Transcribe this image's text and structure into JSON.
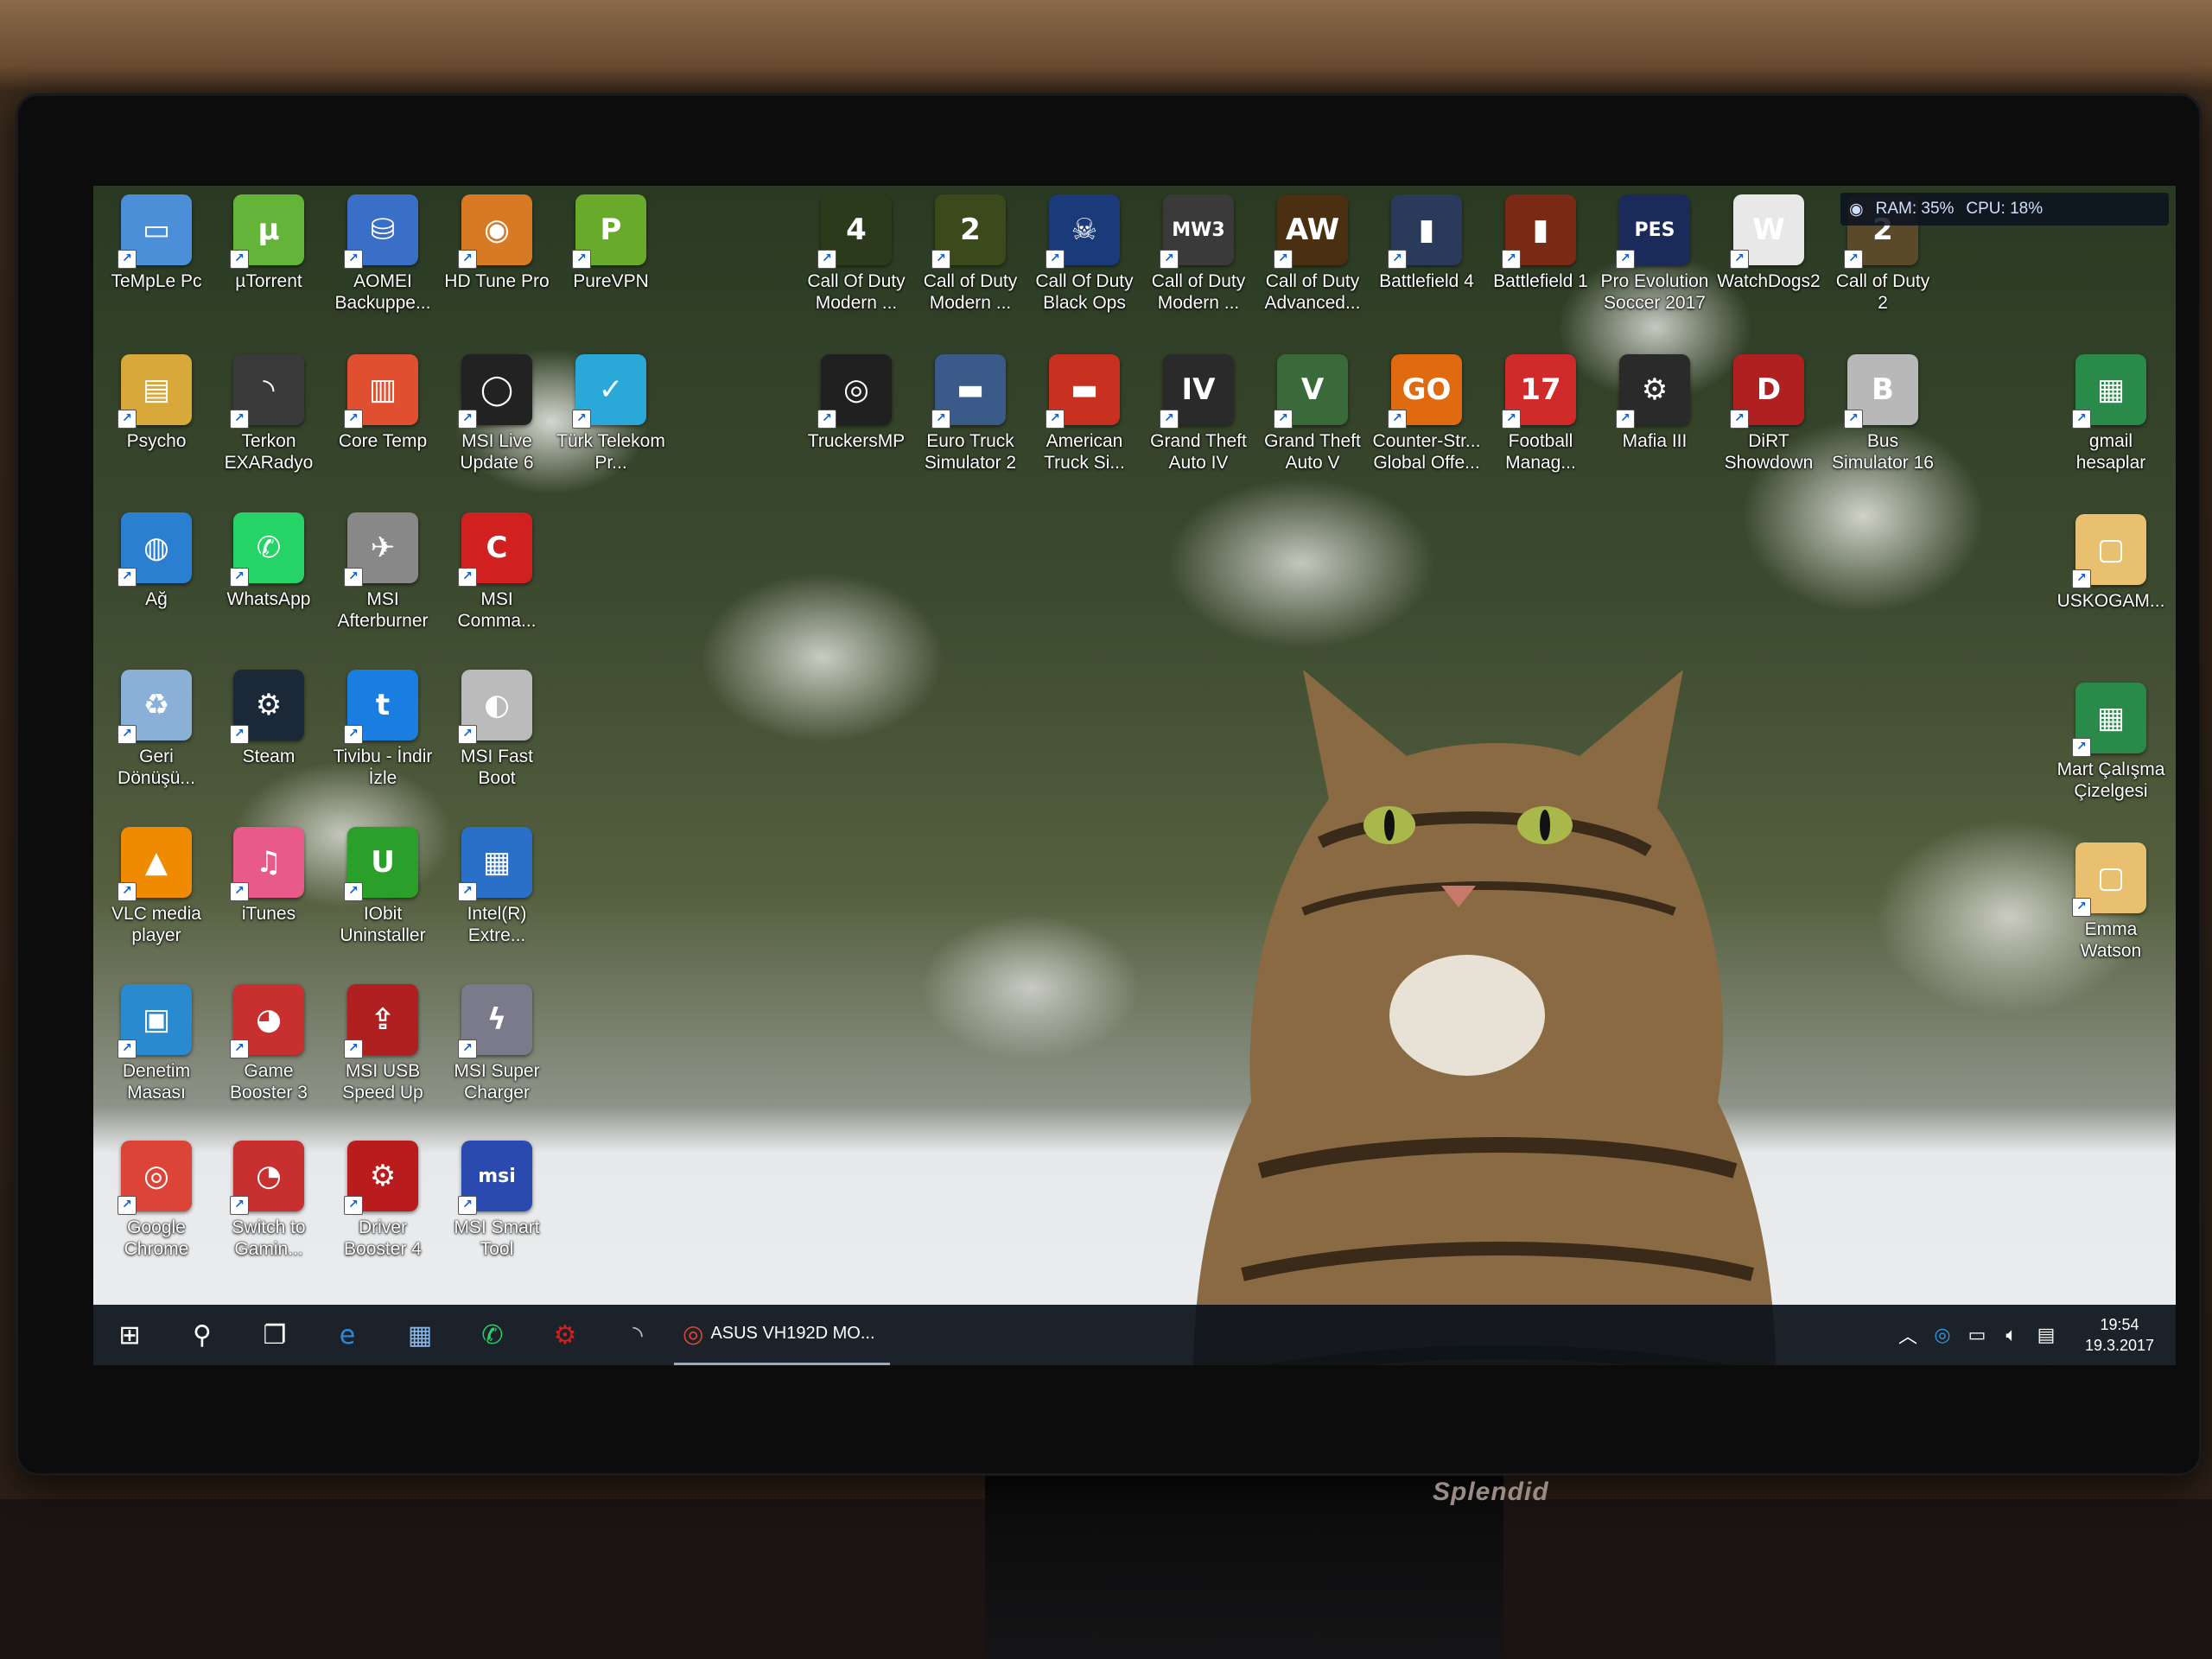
{
  "desktop": {
    "icons": [
      {
        "label": "TeMpLe Pc",
        "color": "#4a8fd8",
        "glyph": "▭"
      },
      {
        "label": "µTorrent",
        "color": "#64b43a",
        "glyph": "µ"
      },
      {
        "label": "AOMEI Backuppe...",
        "color": "#3a6fc8",
        "glyph": "⛁"
      },
      {
        "label": "HD Tune Pro",
        "color": "#d87a24",
        "glyph": "◉"
      },
      {
        "label": "PureVPN",
        "color": "#6aaa2a",
        "glyph": "P"
      },
      {
        "label": "Psycho",
        "color": "#d8a83a",
        "glyph": "▤"
      },
      {
        "label": "Terkon EXARadyo",
        "color": "#3a3a3a",
        "glyph": "◝"
      },
      {
        "label": "Core Temp",
        "color": "#e05030",
        "glyph": "▥"
      },
      {
        "label": "MSI Live Update 6",
        "color": "#222222",
        "glyph": "◯"
      },
      {
        "label": "Türk Telekom Pr...",
        "color": "#2aa8d8",
        "glyph": "✓"
      },
      {
        "label": "Ağ",
        "color": "#2a7fd0",
        "glyph": "◍"
      },
      {
        "label": "WhatsApp",
        "color": "#25d366",
        "glyph": "✆"
      },
      {
        "label": "MSI Afterburner",
        "color": "#888888",
        "glyph": "✈"
      },
      {
        "label": "MSI Comma...",
        "color": "#d02020",
        "glyph": "C"
      },
      {
        "label": "Geri Dönüşü...",
        "color": "#8ab0d8",
        "glyph": "♻"
      },
      {
        "label": "Steam",
        "color": "#1b2838",
        "glyph": "⚙"
      },
      {
        "label": "Tivibu - İndir İzle",
        "color": "#1a7ee0",
        "glyph": "t"
      },
      {
        "label": "MSI Fast Boot",
        "color": "#bbbbbb",
        "glyph": "◐"
      },
      {
        "label": "VLC media player",
        "color": "#f08a00",
        "glyph": "▲"
      },
      {
        "label": "iTunes",
        "color": "#e85a8a",
        "glyph": "♫"
      },
      {
        "label": "IObit Uninstaller",
        "color": "#2aa02a",
        "glyph": "U"
      },
      {
        "label": "Intel(R) Extre...",
        "color": "#2a70c8",
        "glyph": "▦"
      },
      {
        "label": "Denetim Masası",
        "color": "#2a8ad0",
        "glyph": "▣"
      },
      {
        "label": "Game Booster 3",
        "color": "#c83030",
        "glyph": "◕"
      },
      {
        "label": "MSI USB Speed Up",
        "color": "#b02020",
        "glyph": "⇪"
      },
      {
        "label": "MSI Super Charger",
        "color": "#7a7a8a",
        "glyph": "ϟ"
      },
      {
        "label": "Google Chrome",
        "color": "#db4437",
        "glyph": "◎"
      },
      {
        "label": "Switch to Gamin...",
        "color": "#c83030",
        "glyph": "◔"
      },
      {
        "label": "Driver Booster 4",
        "color": "#b81c1c",
        "glyph": "⚙"
      },
      {
        "label": "MSI Smart Tool",
        "color": "#2a4ab0",
        "glyph": "msi"
      },
      {
        "label": "Call Of Duty Modern ...",
        "color": "#2a3a1a",
        "glyph": "4"
      },
      {
        "label": "Call of Duty Modern ...",
        "color": "#3a4a1a",
        "glyph": "2"
      },
      {
        "label": "Call Of Duty Black Ops",
        "color": "#1a3a7a",
        "glyph": "☠"
      },
      {
        "label": "Call of Duty Modern ...",
        "color": "#3a3a3a",
        "glyph": "MW3"
      },
      {
        "label": "Call of Duty Advanced...",
        "color": "#4a3010",
        "glyph": "AW"
      },
      {
        "label": "Battlefield 4",
        "color": "#2a3a5a",
        "glyph": "▮"
      },
      {
        "label": "Battlefield 1",
        "color": "#7a2a14",
        "glyph": "▮"
      },
      {
        "label": "Pro Evolution Soccer 2017",
        "color": "#1a2a5a",
        "glyph": "PES"
      },
      {
        "label": "WatchDogs2",
        "color": "#e8e8e8",
        "glyph": "W"
      },
      {
        "label": "Call of Duty 2",
        "color": "#5a4a2a",
        "glyph": "2"
      },
      {
        "label": "TruckersMP",
        "color": "#202020",
        "glyph": "◎"
      },
      {
        "label": "Euro Truck Simulator 2",
        "color": "#3a5a8a",
        "glyph": "▬"
      },
      {
        "label": "American Truck Si...",
        "color": "#c83020",
        "glyph": "▬"
      },
      {
        "label": "Grand Theft Auto IV",
        "color": "#2a2a2a",
        "glyph": "IV"
      },
      {
        "label": "Grand Theft Auto V",
        "color": "#3a6a3a",
        "glyph": "V"
      },
      {
        "label": "Counter-Str... Global Offe...",
        "color": "#e06a10",
        "glyph": "GO"
      },
      {
        "label": "Football Manag...",
        "color": "#d02a2a",
        "glyph": "17"
      },
      {
        "label": "Mafia III",
        "color": "#2a2a2a",
        "glyph": "⚙"
      },
      {
        "label": "DiRT Showdown",
        "color": "#b02020",
        "glyph": "D"
      },
      {
        "label": "Bus Simulator 16",
        "color": "#b8b8b8",
        "glyph": "B"
      },
      {
        "label": "gmail hesaplar",
        "color": "#2a8a4a",
        "glyph": "▦"
      },
      {
        "label": "USKOGAM...",
        "color": "#e8c070",
        "glyph": "▢"
      },
      {
        "label": "Mart Çalışma Çizelgesi",
        "color": "#2a8a4a",
        "glyph": "▦"
      },
      {
        "label": "Emma Watson",
        "color": "#e8c070",
        "glyph": "▢"
      }
    ]
  },
  "sysmon": {
    "ram": "RAM: 35%",
    "cpu": "CPU: 18%"
  },
  "taskbar": {
    "chrome_task_label": "ASUS VH192D MO...",
    "time": "19:54",
    "date": "19.3.2017"
  },
  "monitor": {
    "brand": "Splendid"
  }
}
